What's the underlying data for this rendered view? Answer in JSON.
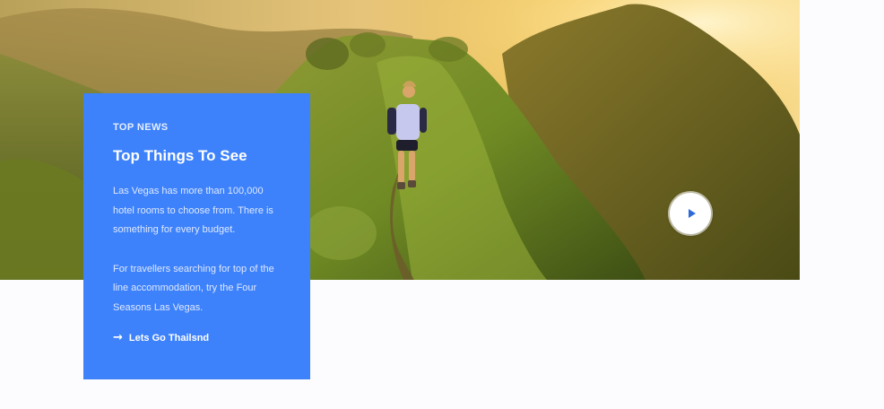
{
  "hero": {
    "image_alt": "Hiker walking along a grassy mountain ridge at sunset",
    "play_icon": "play-icon"
  },
  "card": {
    "eyebrow": "TOP NEWS",
    "title": "Top Things To See",
    "paragraph_1": "Las Vegas has more than 100,000 hotel rooms to choose from.  There is something for every budget.",
    "paragraph_2": "For travellers searching for top of the line accommodation, try the Four Seasons Las Vegas.",
    "cta_icon": "arrow-right-icon",
    "cta_label": "Lets Go Thailsnd",
    "background_color": "#3d82fb"
  }
}
